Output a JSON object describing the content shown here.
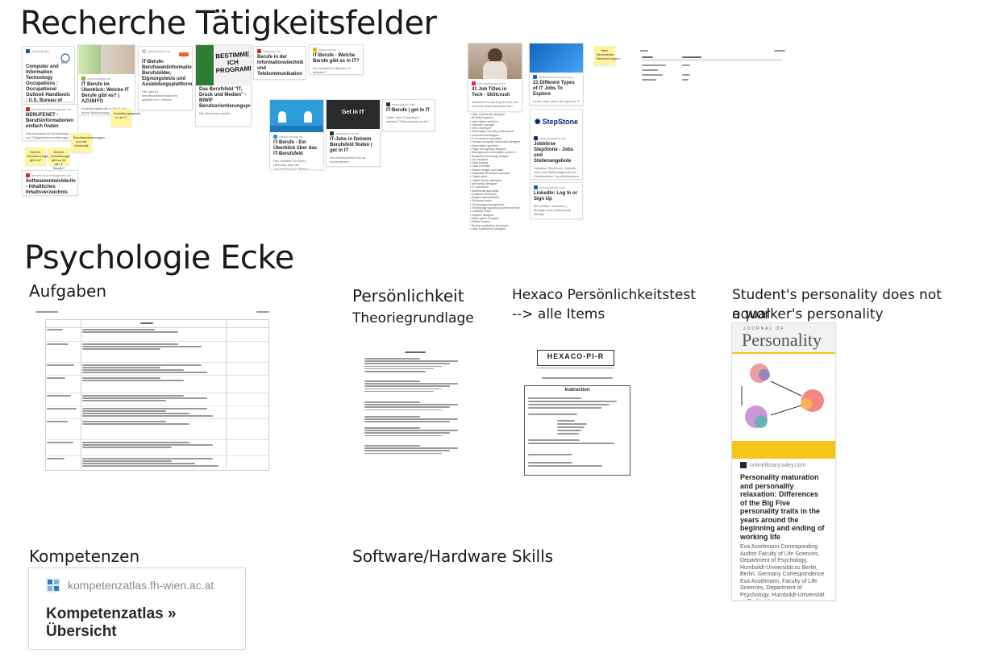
{
  "section1": {
    "title": "Recherche Tätigkeitsfelder"
  },
  "section2": {
    "title": "Psychologie Ecke"
  },
  "frames": {
    "aufgaben": "Aufgaben",
    "persoenlichkeit_1": "Persönlichkeit",
    "persoenlichkeit_2": "Theoriegrundlage",
    "hexaco_1": "Hexaco Persönlichkeitstest",
    "hexaco_2": "--> alle Items",
    "student_1": "Student's personality does not equal",
    "student_2": "a worker's personality",
    "kompetenzen": "Kompetenzen",
    "software": "Software/Hardware Skills"
  },
  "cards": {
    "bls": {
      "domain": "www.bls.gov",
      "title": "Computer and Information Technology Occupations : Occupational Outlook Handbook: : U.S. Bureau of Labor Statistics"
    },
    "azubiyo": {
      "domain": "www.azubiyo.de",
      "title": "IT Berufe im Überblick: Welche IT Berufe gibt es? | AZUBIYO",
      "desc": "Ausbildungsberufe in der IT und deren Bezeichnung"
    },
    "berufsbilder": {
      "domain": "www.karriere.at",
      "title": "IT-Berufe: Berufswahlinformationen: Berufsbilder, Eignungstests und Ausbildungsplattformen",
      "desc": "Hier gibt es Berufswahlinformationen speziell für IT-Berufe"
    },
    "programmierer": {
      "thumb_text": "BESTIMME ICH PROGRAMMIER",
      "title": "Das Berufsfeld \"IT, Druck und Medien\" - BIWIF Berufsorientierungsprogramm",
      "desc": "Die Mischung macht's"
    },
    "berufe_it": {
      "domain": "www.ams.at",
      "title": "Berufe in der Informationstechnik und Telekommunikation"
    },
    "welche_berufe": {
      "domain": "www.ams.at",
      "title": "IT-Berufe - Welche Berufe gibt es in IT?",
      "desc": "Du möchtest im Bereich IT arbeiten?"
    },
    "berufenet": {
      "domain": "berufenet.arbeitsagentur.de",
      "title": "BERUFENET - Berufsinformationen einfach finden",
      "desc": "Das Netzwerk für Ausbildungs- und Tätigkeitsbeschreibungen der Bundesagentur für Arbeit"
    },
    "softwareentw": {
      "domain": "berufenet.arbeitsagentur.de",
      "title": "Softwareentwickler/in - Inhaltliches Inhaltsverzeichnis"
    },
    "ueberblick": {
      "domain": "www.it-berufe.de",
      "title": "IT-Berufe - Ein Überblick über das IT-Berufsfeld",
      "desc": "Hier erhalten Sie einen Überblick über die verschiedenen IT-Berufe"
    },
    "itjobs": {
      "thumb_text": "Get in IT",
      "domain": "www.get-in-it.de",
      "title": "IT-Jobs in Deinem Berufsfeld finden | get in IT",
      "desc": "Als Einstieg bieten wir dir Informationen"
    },
    "getinit": {
      "domain": "www.get-in-it.de",
      "title": "IT-Berufe | get in IT",
      "desc": "Cyber oder Consultant – welcher IT-Beruf passt zu dir?"
    },
    "jobtitles": {
      "domain": "www.skillcrush.com",
      "title": "41 Job Titles in Tech - Skillcrush",
      "desc": "Interested in working in tech, but not sure what that looks like?"
    },
    "types": {
      "domain": "www.freecodecamp.org",
      "title": "21 Different Types of IT Jobs To Explore",
      "desc": "Learn more about the types of IT jobs"
    },
    "stepstone": {
      "logo": "StepStone",
      "domain": "www.stepstone.de",
      "title": "Jobbörse StepStone - Jobs und Stellenangebote",
      "desc": "Jobbörse StepStone: Aktuelle Jobs und Stellenangebote bei Deutschlands Top-Arbeitgebern"
    },
    "linkedin": {
      "domain": "www.linkedin.com",
      "title": "LinkedIn: Log In or Sign Up",
      "desc": "500 million+ members | Manage your professional identity"
    },
    "wiley": {
      "logo_top": "JOURNAL OF",
      "logo": "Personality",
      "domain": "onlinelibrary.wiley.com",
      "title": "Personality maturation and personality relaxation: Differences of the Big Five personality traits in the years around the beginning and ending of working life",
      "desc": "Eva Asselmann Corresponding Author Faculty of Life Sciences, Department of Psychology, Humboldt-Universität zu Berlin, Berlin, Germany Correspondence Eva Asselmann, Faculty of Life Sciences, Department of Psychology, Humboldt-Universität zu Berlin, Unte..."
    }
  },
  "stickies": {
    "s1": "Ausbildungsberufe in der IT",
    "s2": "Berufsbezeichnungen aus der Informatik",
    "s3": "Welche Bezeichnungen gibt es?",
    "s4": "Welche Ausbildungen gibt es für die IT-Berufe?",
    "s5": "Mehr Berufsfelder: Bezeichnungen?",
    "s6": "Welche Berufsbezeichnungen gibt es?"
  },
  "job_list": [
    "User experience designer",
    "Mobility engineer",
    "Information architect",
    "Network manager",
    "Web developer",
    "Information security professional",
    "Instructional designer",
    "E-Commerce specialist",
    "Human-computer interaction designer",
    "Information architect",
    "Page and lighting designer",
    "Management information systems",
    "Business technology analyst",
    "UX designer",
    "Data Analyst",
    "Data Scientist",
    "Search engine specialist",
    "Database developer manager",
    "Digital artist",
    "Digital library specialist",
    "Interaction designer",
    "IT consultant",
    "Multimedia specialist",
    "Software developer",
    "System administrator",
    "Technical writer",
    "Technology management",
    "Technology support/customer service",
    "Usability tester",
    "Graphic designer",
    "Video game designer",
    "Ethical hacker",
    "Mobile application developer",
    "User Experience Designer"
  ],
  "hexaco": {
    "title": "HEXACO-PI-R",
    "section": "Instruction"
  },
  "personality_doc": {
    "title": "Persönlichkeit"
  },
  "kompetenzatlas": {
    "domain": "kompetenzatlas.fh-wien.ac.at",
    "title": "Kompetenzatlas » Übersicht"
  },
  "colors": {
    "sticky": "#fff59d",
    "stepstone": "#0c2577",
    "linkedin": "#0a66c2",
    "wiley_yellow": "#f5c518"
  }
}
